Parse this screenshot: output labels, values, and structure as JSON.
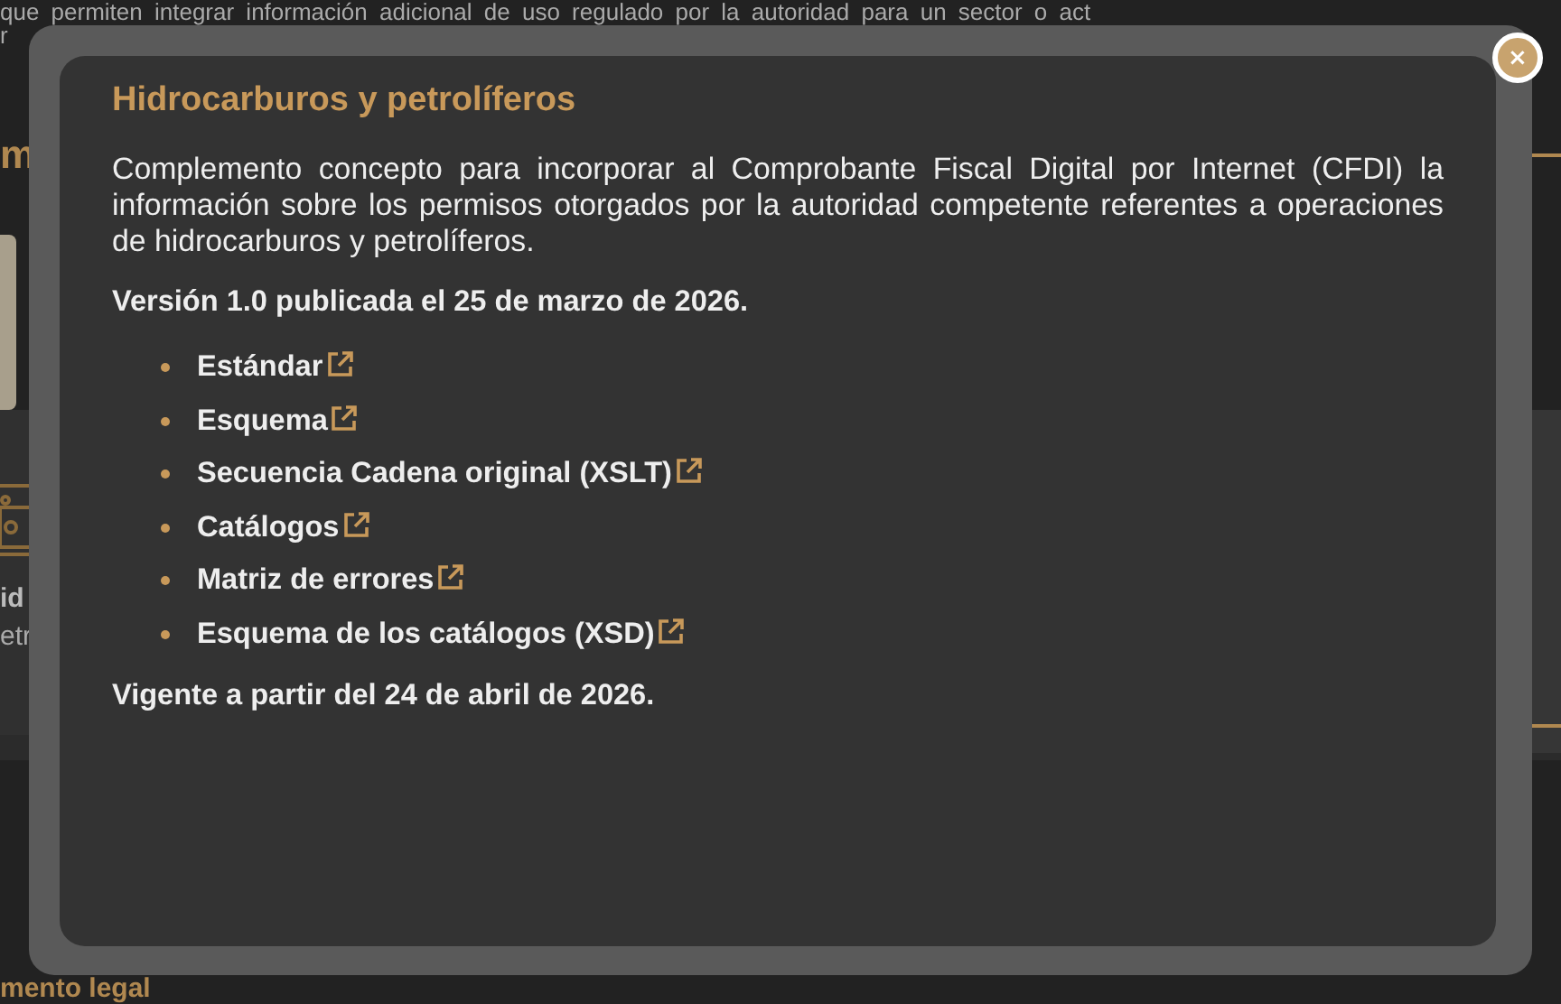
{
  "background": {
    "intro_lines": [
      "que permiten integrar información adicional de uso regulado por la autoridad para un sector o act",
      "r"
    ],
    "heading_fragment": "m",
    "card_lines": [
      "id",
      "etr"
    ],
    "footer_heading_fragment": "mento legal"
  },
  "modal": {
    "close": "×",
    "title": "Hidrocarburos y petrolíferos",
    "description": "Complemento concepto para incorporar al Comprobante Fiscal Digital por Internet (CFDI) la información sobre los permisos otorgados por la autoridad competente referentes a operaciones de hidrocarburos y petrolíferos.",
    "version": "Versión 1.0 publicada el 25 de marzo de 2026.",
    "links": [
      "Estándar",
      "Esquema",
      "Secuencia Cadena original (XSLT)",
      "Catálogos",
      "Matriz de errores",
      "Esquema de los catálogos (XSD)"
    ],
    "validity": "Vigente a partir del 24 de abril de 2026."
  }
}
